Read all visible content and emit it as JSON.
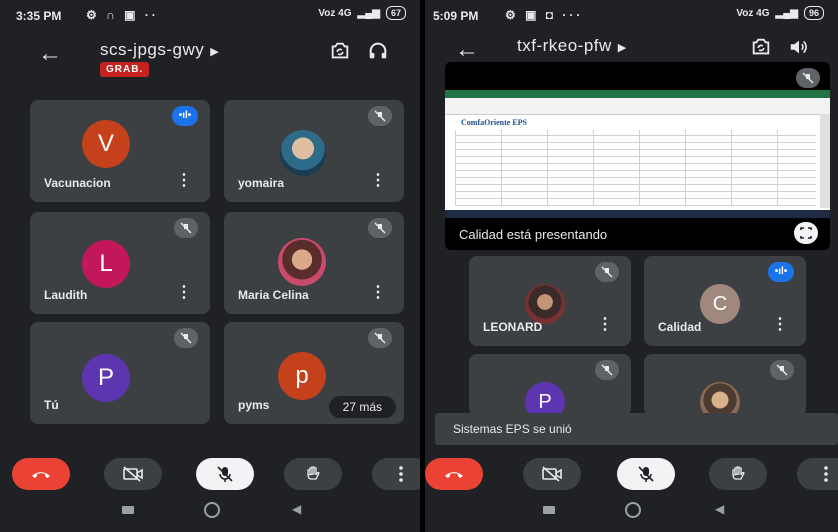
{
  "left": {
    "status": {
      "time": "3:35 PM",
      "network": "Voz 4G",
      "battery": "67"
    },
    "meeting_code": "scs-jpgs-gwy",
    "rec_badge": "GRAB.",
    "tiles": [
      {
        "name": "Vacunacion",
        "initial": "V",
        "color": "#c5411b",
        "speaking": true
      },
      {
        "name": "yomaira",
        "photo": true
      },
      {
        "name": "Laudith",
        "initial": "L",
        "color": "#c2185b"
      },
      {
        "name": "Maria Celina",
        "photo": true
      },
      {
        "name": "Tú",
        "initial": "P",
        "color": "#5e35b1"
      },
      {
        "name": "pyms",
        "initial": "p",
        "color": "#c5411b",
        "more": "27 más"
      }
    ]
  },
  "right": {
    "status": {
      "time": "5:09 PM",
      "network": "Voz 4G",
      "battery": "96"
    },
    "meeting_code": "txf-rkeo-pfw",
    "presenting": "Calidad está presentando",
    "sheet_brand": "ComfaOriente EPS",
    "tiles": [
      {
        "name": "LEONARD",
        "photo": true
      },
      {
        "name": "Calidad",
        "initial": "C",
        "color": "#a1887f",
        "speaking": true
      },
      {
        "name": "",
        "initial": "P",
        "color": "#5e35b1"
      },
      {
        "name": "",
        "photo": true
      }
    ],
    "toast": "Sistemas EPS se unió"
  },
  "icons": {
    "back": "arrow-left-icon",
    "switch_camera": "switch-camera-icon",
    "headphones": "headphones-icon",
    "speaker": "speaker-icon",
    "mic_off": "mic-off-icon",
    "end_call": "end-call-icon",
    "video_off": "video-off-icon",
    "raise_hand": "raise-hand-icon",
    "more": "more-vert-icon"
  }
}
